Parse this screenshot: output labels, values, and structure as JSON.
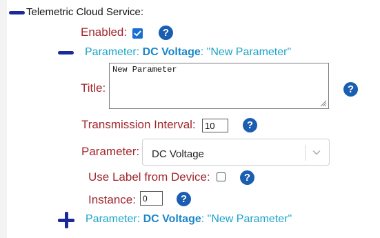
{
  "section": {
    "title": "Telemetric Cloud Service:"
  },
  "enabled": {
    "label": "Enabled:",
    "checked": true
  },
  "parameter_header": {
    "prefix": "Parameter: ",
    "name": "DC Voltage",
    "suffix": ": \"New Parameter\""
  },
  "title_field": {
    "label": "Title:",
    "value": "New Parameter"
  },
  "transmission_interval": {
    "label": "Transmission Interval:",
    "value": "10"
  },
  "parameter_select": {
    "label": "Parameter:",
    "selected": "DC Voltage"
  },
  "use_label": {
    "label": "Use Label from Device:",
    "checked": false
  },
  "instance": {
    "label": "Instance:",
    "value": "0"
  },
  "add_parameter": {
    "prefix": "Parameter: ",
    "name": "DC Voltage",
    "suffix": ": \"New Parameter\""
  },
  "help_glyph": "?",
  "icons": {
    "collapse": "minus-icon",
    "expand": "plus-icon",
    "help": "question-circle-icon",
    "dropdown": "chevron-down-icon",
    "resize": "resize-grip-icon",
    "check": "check-icon"
  },
  "colors": {
    "label_red": "#a0262c",
    "link_cyan": "#1aa3c9",
    "help_blue": "#1b5eb1",
    "toggle_navy": "#1a2a9a",
    "checkbox_blue": "#1a6fd1"
  }
}
